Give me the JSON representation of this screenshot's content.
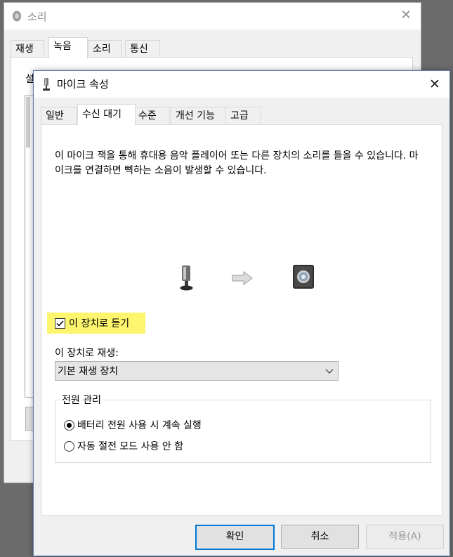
{
  "background_window": {
    "title": "소리",
    "close_glyph": "✕",
    "tabs": [
      "재생",
      "녹음",
      "소리",
      "통신"
    ],
    "active_tab": 1,
    "partial_label": "설"
  },
  "dialog": {
    "title": "마이크 속성",
    "close_glyph": "✕",
    "tabs": [
      {
        "label": "일반"
      },
      {
        "label": "수신 대기"
      },
      {
        "label": "수준"
      },
      {
        "label": "개선 기능"
      },
      {
        "label": "고급"
      }
    ],
    "active_tab": 1,
    "description": "이 마이크 잭을 통해 휴대용 음악 플레이어 또는 다른 장치의 소리를 들을 수 있습니다. 마이크를 연결하면 삑하는 소음이 발생할 수 있습니다.",
    "illustration": {
      "left_icon": "microphone-icon",
      "arrow_icon": "arrow-right-icon",
      "right_icon": "speaker-icon"
    },
    "listen": {
      "label": "이 장치로 듣기",
      "checked": true,
      "highlight": "#fdf56e"
    },
    "playback": {
      "label": "이 장치로 재생:",
      "selected": "기본 재생 장치"
    },
    "power": {
      "title": "전원 관리",
      "options": [
        {
          "label": "배터리 전원 사용 시 계속 실행",
          "selected": true
        },
        {
          "label": "자동 절전 모드 사용 안 함",
          "selected": false
        }
      ]
    },
    "buttons": {
      "ok": "확인",
      "cancel": "취소",
      "apply": "적용(A)"
    }
  },
  "colors": {
    "accent": "#0078d7",
    "highlight": "#fdf56e"
  }
}
